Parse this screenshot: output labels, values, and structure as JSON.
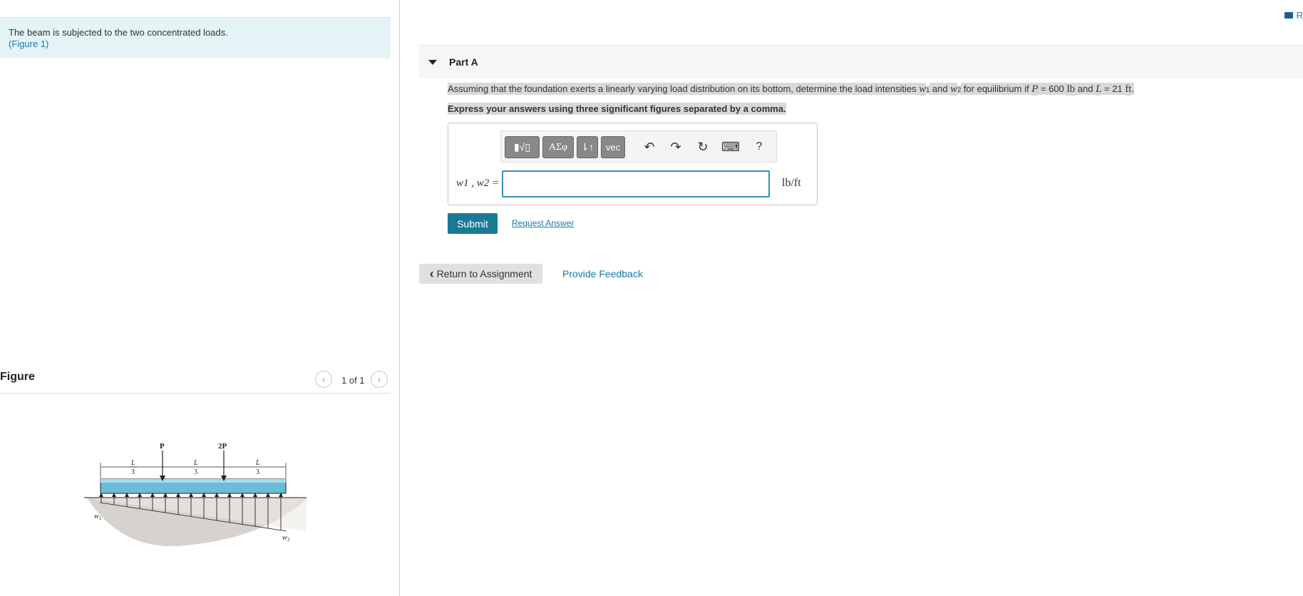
{
  "intro": {
    "text": "The beam is subjected to the two concentrated loads.",
    "link_open": "(",
    "link": "Figure 1",
    "link_close": ")"
  },
  "figure": {
    "title": "Figure",
    "pager": "1 of 1",
    "labels": {
      "p": "P",
      "p2": "2P",
      "l": "L",
      "three": "3",
      "w1": "w",
      "w1sub": "1",
      "w2": "w",
      "w2sub": "2"
    }
  },
  "right_edge": "R",
  "part": {
    "label": "Part A"
  },
  "question": {
    "t1": "Assuming that the foundation exerts a linearly varying load distribution on its bottom, determine the load intensities ",
    "w": "w",
    "sub1": "1",
    "t2": " and ",
    "sub2": "2",
    "t3": " for equilibrium if ",
    "p": "P",
    "t4": " = 600 ",
    "lb": "lb",
    "t5": " and ",
    "l": "L",
    "t6": " = 21 ",
    "ft": "ft",
    "t7": ".",
    "instruction": "Express your answers using three significant figures separated by a comma."
  },
  "answer": {
    "label": "w1 , w2 =",
    "value": "",
    "unit": "lb/ft",
    "toolbar": {
      "templates": "▮√▯",
      "greek": "ΑΣφ",
      "arrows": "⇂↑",
      "vec": "vec",
      "undo": "↶",
      "redo": "↷",
      "reset": "↻",
      "keyboard": "⌨",
      "help": "?"
    }
  },
  "buttons": {
    "submit": "Submit",
    "request": "Request Answer",
    "return": "Return to Assignment",
    "return_icon": "‹",
    "feedback": "Provide Feedback"
  },
  "icons": {
    "prev": "chevron-left-icon",
    "next": "chevron-right-icon",
    "collapse": "triangle-down-icon"
  },
  "colors": {
    "accent": "#1a7a96",
    "link": "#1a7aa8",
    "intro_bg": "#e4f4f6"
  }
}
